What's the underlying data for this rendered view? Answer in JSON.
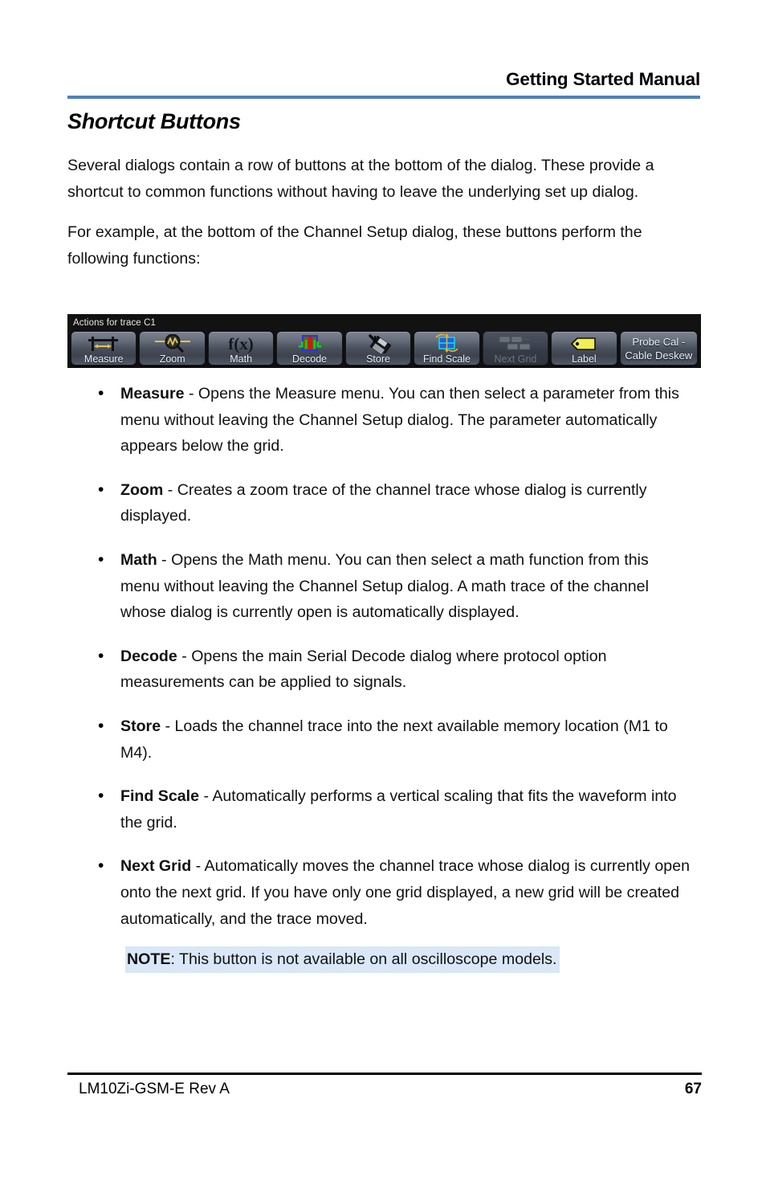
{
  "header": {
    "title": "Getting Started Manual",
    "rule_color": "#4e81bd"
  },
  "section": {
    "title": "Shortcut Buttons"
  },
  "intro": {
    "paragraph_1": "Several dialogs contain a row of buttons at the bottom of the dialog. These provide a shortcut to common functions without having to leave the underlying set up dialog.",
    "paragraph_2": "For example, at the bottom of the Channel Setup dialog, these buttons perform the following functions:"
  },
  "toolbar": {
    "caption": "Actions for trace C1",
    "background": "#121212",
    "buttons": [
      {
        "label": "Measure",
        "icon": "measure-width-icon",
        "disabled": false
      },
      {
        "label": "Zoom",
        "icon": "magnifier-waveform-icon",
        "disabled": false
      },
      {
        "label": "Math",
        "icon": "fx-function-icon",
        "disabled": false
      },
      {
        "label": "Decode",
        "icon": "decode-waveform-icon",
        "disabled": false
      },
      {
        "label": "Store",
        "icon": "floppy-disk-arrow-icon",
        "disabled": false
      },
      {
        "label": "Find Scale",
        "icon": "grid-resize-arrows-icon",
        "disabled": false
      },
      {
        "label": "Next Grid",
        "icon": "grid-move-icon",
        "disabled": true
      },
      {
        "label": "Label",
        "icon": "tag-label-icon",
        "disabled": false
      },
      {
        "label": "Probe Cal -\nCable Deskew",
        "label_line_1": "Probe Cal -",
        "label_line_2": "Cable Deskew",
        "icon": "none",
        "disabled": false,
        "text_only": true
      }
    ]
  },
  "bullets": [
    {
      "marker": "•",
      "term": "Measure",
      "description": " - Opens the Measure menu. You can then select a parameter from this menu without leaving the Channel Setup dialog. The parameter automatically appears below the grid."
    },
    {
      "marker": "•",
      "term": "Zoom",
      "description": " - Creates a zoom trace of the channel trace whose dialog is currently displayed."
    },
    {
      "marker": "•",
      "term": "Math",
      "description": " - Opens the Math menu. You can then select a math function from this menu without leaving the Channel Setup dialog. A math trace of the channel whose dialog is currently open is automatically displayed."
    },
    {
      "marker": "•",
      "term": "Decode",
      "description": " - Opens the main Serial Decode dialog where protocol option measurements can be applied to signals."
    },
    {
      "marker": "•",
      "term": "Store",
      "description": " - Loads the channel trace into the next available memory location (M1 to M4)."
    },
    {
      "marker": "•",
      "term": "Find Scale",
      "description": " - Automatically performs a vertical scaling that fits the waveform into the grid."
    },
    {
      "marker": "•",
      "term": "Next Grid",
      "description": " - Automatically moves the channel trace whose dialog is currently open onto the next grid. If you have only one grid displayed, a new grid will be created automatically, and the trace moved."
    }
  ],
  "note": {
    "term": "NOTE",
    "text": ": This button is not available on all oscilloscope models.",
    "highlight_color": "#d9e7f7"
  },
  "footer": {
    "left": "LM10Zi-GSM-E Rev A",
    "page_number": "67"
  }
}
